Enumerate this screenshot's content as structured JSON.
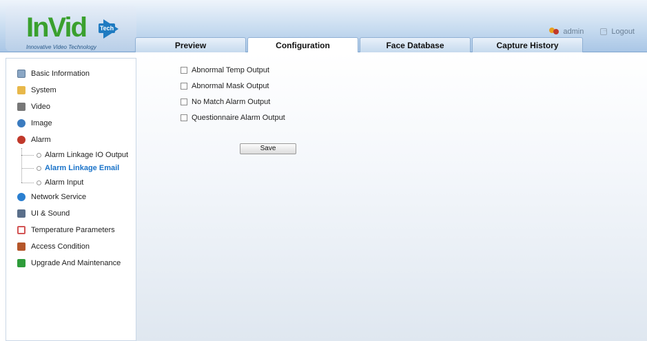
{
  "logo": {
    "brand": "InVid",
    "badge": "Tech",
    "tagline": "Innovative Video Technology"
  },
  "header": {
    "user": "admin",
    "logout": "Logout"
  },
  "tabs": [
    {
      "label": "Preview"
    },
    {
      "label": "Configuration",
      "active": true
    },
    {
      "label": "Face Database"
    },
    {
      "label": "Capture History"
    }
  ],
  "sidebar": {
    "items": [
      {
        "label": "Basic Information",
        "icon": "document-icon",
        "color": "#8aa6c4"
      },
      {
        "label": "System",
        "icon": "folder-icon",
        "color": "#e8b84a"
      },
      {
        "label": "Video",
        "icon": "film-icon",
        "color": "#777777"
      },
      {
        "label": "Image",
        "icon": "image-icon",
        "color": "#3b7bbf"
      },
      {
        "label": "Alarm",
        "icon": "alarm-icon",
        "color": "#c0392b"
      },
      {
        "label": "Network Service",
        "icon": "network-icon",
        "color": "#2a7fd0"
      },
      {
        "label": "UI & Sound",
        "icon": "ui-sound-icon",
        "color": "#5a6f8a"
      },
      {
        "label": "Temperature Parameters",
        "icon": "temperature-icon",
        "color": "#d35454"
      },
      {
        "label": "Access Condition",
        "icon": "access-icon",
        "color": "#b5562a"
      },
      {
        "label": "Upgrade And Maintenance",
        "icon": "upgrade-icon",
        "color": "#2e9c3a"
      }
    ],
    "alarm_sub": [
      {
        "label": "Alarm Linkage IO Output",
        "active": false
      },
      {
        "label": "Alarm Linkage Email",
        "active": true
      },
      {
        "label": "Alarm Input",
        "active": false
      }
    ]
  },
  "form": {
    "options": [
      {
        "label": "Abnormal Temp Output",
        "checked": false
      },
      {
        "label": "Abnormal Mask Output",
        "checked": false
      },
      {
        "label": "No Match Alarm Output",
        "checked": false
      },
      {
        "label": "Questionnaire Alarm Output",
        "checked": false
      }
    ],
    "save_label": "Save"
  }
}
